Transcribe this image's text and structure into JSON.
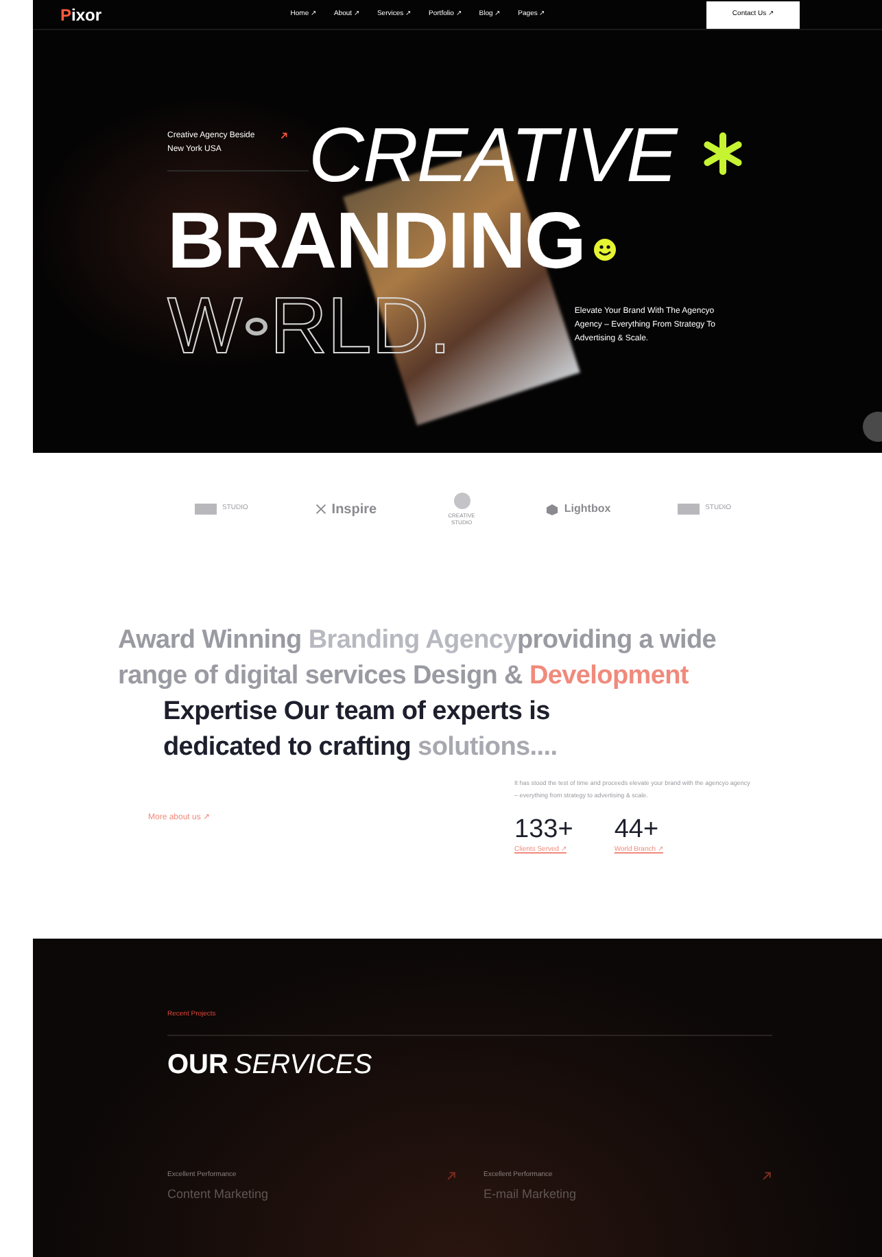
{
  "header": {
    "logo": {
      "initial": "P",
      "rest": "ixor"
    },
    "nav": [
      {
        "label": "Home ↗"
      },
      {
        "label": "About ↗"
      },
      {
        "label": "Services ↗"
      },
      {
        "label": "Portfolio ↗"
      },
      {
        "label": "Blog ↗"
      },
      {
        "label": "Pages ↗"
      }
    ],
    "cta": "Contact Us ↗"
  },
  "hero": {
    "tagline": "Creative Agency Beside New York USA",
    "line1": "CREATIVE",
    "line2": "BRANDING",
    "line3_start": "W",
    "line3_end": "RLD.",
    "description": "Elevate Your Brand With The Agencyo Agency – Everything From Strategy To Advertising & Scale."
  },
  "brands": [
    {
      "kind": "block",
      "label": "STUDIO"
    },
    {
      "kind": "inspire",
      "label": "Inspire"
    },
    {
      "kind": "circle",
      "label": "CREATIVE STUDIO"
    },
    {
      "kind": "lightbox",
      "label": "Lightbox"
    },
    {
      "kind": "block",
      "label": "STUDIO"
    }
  ],
  "about": {
    "paragraph1": [
      {
        "text": "Award Winning ",
        "color": "#9a9aa2"
      },
      {
        "text": "Branding Agency",
        "color": "#b8b8c0"
      },
      {
        "text": "providing a wide range of digital services Design & ",
        "color": "#9a9aa2"
      },
      {
        "text": "Development",
        "color": "#f08a7c"
      }
    ],
    "paragraph2": [
      {
        "text": "Expertise Our team  of experts is dedicated to crafting ",
        "color": "#1d1f2c"
      },
      {
        "text": "solutions....",
        "color": "#a8a8b0"
      }
    ],
    "link": "More about us ↗",
    "blurb": "It has stood the test of time and proceeds elevate your brand with the agencyo agency – everything from strategy to advertising & scale.",
    "stats": [
      {
        "value": "133+",
        "label": "Clients Served ↗"
      },
      {
        "value": "44+",
        "label": "World Branch ↗"
      }
    ]
  },
  "services": {
    "eyebrow": "Recent Projects",
    "title_bold": "OUR",
    "title_italic": "SERVICES",
    "cards": [
      {
        "subtitle": "Excellent Performance",
        "name": "Content Marketing"
      },
      {
        "subtitle": "Excellent Performance",
        "name": "E-mail Marketing"
      }
    ]
  }
}
